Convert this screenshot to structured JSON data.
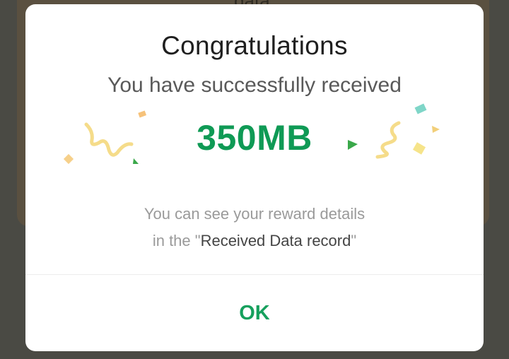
{
  "background": {
    "partial_text": "data."
  },
  "dialog": {
    "title": "Congratulations",
    "subtitle": "You have successfully received",
    "amount": "350MB",
    "note_line1": "You can see your reward details",
    "note_line2_prefix": "in the \"",
    "note_line2_link": "Received Data record",
    "note_line2_suffix": "\"",
    "ok_label": "OK"
  },
  "colors": {
    "accent": "#0f9a55",
    "ok": "#16a05d"
  }
}
